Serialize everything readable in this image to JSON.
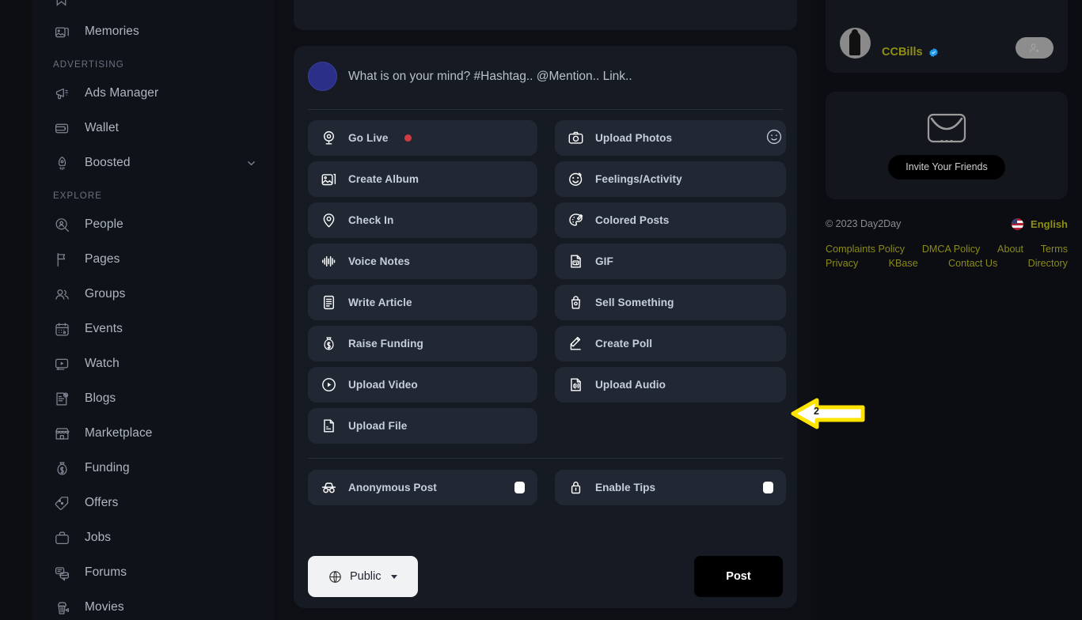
{
  "sidebar": {
    "items_top": [
      {
        "label": "Memories",
        "icon": "memories-icon"
      }
    ],
    "sections": [
      {
        "title": "ADVERTISING",
        "items": [
          {
            "label": "Ads Manager",
            "icon": "megaphone-icon",
            "chevron": false
          },
          {
            "label": "Wallet",
            "icon": "wallet-icon",
            "chevron": false
          },
          {
            "label": "Boosted",
            "icon": "rocket-icon",
            "chevron": true
          }
        ]
      },
      {
        "title": "EXPLORE",
        "items": [
          {
            "label": "People",
            "icon": "people-search-icon",
            "chevron": false
          },
          {
            "label": "Pages",
            "icon": "flag-icon",
            "chevron": false
          },
          {
            "label": "Groups",
            "icon": "groups-icon",
            "chevron": false
          },
          {
            "label": "Events",
            "icon": "calendar-icon",
            "chevron": false
          },
          {
            "label": "Watch",
            "icon": "video-icon",
            "chevron": false
          },
          {
            "label": "Blogs",
            "icon": "blog-icon",
            "chevron": false
          },
          {
            "label": "Marketplace",
            "icon": "store-icon",
            "chevron": false
          },
          {
            "label": "Funding",
            "icon": "moneybag-icon",
            "chevron": false
          },
          {
            "label": "Offers",
            "icon": "tag-percent-icon",
            "chevron": false
          },
          {
            "label": "Jobs",
            "icon": "briefcase-icon",
            "chevron": false
          },
          {
            "label": "Forums",
            "icon": "forums-icon",
            "chevron": false
          },
          {
            "label": "Movies",
            "icon": "popcorn-icon",
            "chevron": false
          }
        ]
      }
    ]
  },
  "composer": {
    "placeholder": "What is on your mind? #Hashtag.. @Mention.. Link..",
    "emoji_icon": "smiley-icon",
    "options": [
      {
        "label": "Go Live",
        "icon": "golive-icon",
        "dot": true
      },
      {
        "label": "Upload Photos",
        "icon": "camera-icon",
        "dot": false
      },
      {
        "label": "Create Album",
        "icon": "album-icon",
        "dot": false
      },
      {
        "label": "Feelings/Activity",
        "icon": "feelings-icon",
        "dot": false
      },
      {
        "label": "Check In",
        "icon": "location-pin-icon",
        "dot": false
      },
      {
        "label": "Colored Posts",
        "icon": "palette-icon",
        "dot": false
      },
      {
        "label": "Voice Notes",
        "icon": "waveform-icon",
        "dot": false
      },
      {
        "label": "GIF",
        "icon": "gif-icon",
        "dot": false
      },
      {
        "label": "Write Article",
        "icon": "article-icon",
        "dot": false
      },
      {
        "label": "Sell Something",
        "icon": "sell-icon",
        "dot": false
      },
      {
        "label": "Raise Funding",
        "icon": "moneybag-icon",
        "dot": false
      },
      {
        "label": "Create Poll",
        "icon": "poll-icon",
        "dot": false
      },
      {
        "label": "Upload Video",
        "icon": "play-circle-icon",
        "dot": false
      },
      {
        "label": "Upload Audio",
        "icon": "audio-file-icon",
        "dot": false
      },
      {
        "label": "Upload File",
        "icon": "file-icon",
        "dot": false
      }
    ],
    "toggles": [
      {
        "label": "Anonymous Post",
        "icon": "incognito-icon",
        "on": false
      },
      {
        "label": "Enable Tips",
        "icon": "tips-lock-icon",
        "on": false
      }
    ],
    "privacy_label": "Public",
    "privacy_icon": "globe-icon",
    "post_label": "Post"
  },
  "right": {
    "profile": {
      "name": "CCBills",
      "verified": true,
      "add_friend_icon": "add-user-icon"
    },
    "invite": {
      "icon": "envelope-icon",
      "button_label": "Invite Your Friends"
    },
    "footer": {
      "copyright": "© 2023 Day2Day",
      "language": "English",
      "links_row1": [
        "Complaints Policy",
        "DMCA Policy",
        "About",
        "Terms"
      ],
      "links_row2": [
        "Privacy",
        "KBase",
        "Contact Us",
        "Directory"
      ]
    }
  },
  "annotation": {
    "number": "2",
    "color": "#ffe400"
  }
}
